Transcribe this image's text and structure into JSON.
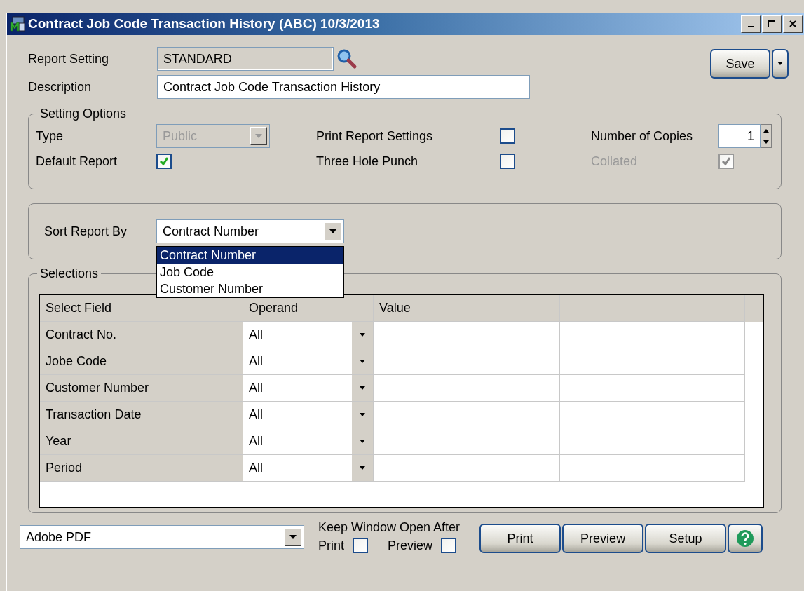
{
  "window": {
    "title": "Contract Job Code Transaction History (ABC) 10/3/2013"
  },
  "report_setting": {
    "label": "Report Setting",
    "value": "STANDARD"
  },
  "description": {
    "label": "Description",
    "value": "Contract Job Code Transaction History"
  },
  "save_button": {
    "label": "Save"
  },
  "setting_options": {
    "title": "Setting Options",
    "type": {
      "label": "Type",
      "value": "Public",
      "disabled": true
    },
    "default_report": {
      "label": "Default Report",
      "checked": true
    },
    "print_report_settings": {
      "label": "Print Report Settings",
      "checked": false
    },
    "three_hole_punch": {
      "label": "Three Hole Punch",
      "checked": false
    },
    "number_of_copies": {
      "label": "Number of Copies",
      "value": "1"
    },
    "collated": {
      "label": "Collated",
      "checked": true,
      "disabled": true
    }
  },
  "sort": {
    "label": "Sort Report By",
    "value": "Contract Number",
    "options": [
      {
        "label": "Contract Number",
        "selected": true
      },
      {
        "label": "Job Code",
        "selected": false
      },
      {
        "label": "Customer Number",
        "selected": false
      }
    ]
  },
  "selections": {
    "title": "Selections",
    "columns": [
      "Select Field",
      "Operand",
      "Value"
    ],
    "rows": [
      {
        "field": "Contract No.",
        "operand": "All"
      },
      {
        "field": "Jobe Code",
        "operand": "All"
      },
      {
        "field": "Customer Number",
        "operand": "All"
      },
      {
        "field": "Transaction Date",
        "operand": "All"
      },
      {
        "field": "Year",
        "operand": "All"
      },
      {
        "field": "Period",
        "operand": "All"
      }
    ]
  },
  "printer": {
    "value": "Adobe PDF"
  },
  "keep_open": {
    "label": "Keep Window Open After",
    "print": {
      "label": "Print",
      "checked": false
    },
    "preview": {
      "label": "Preview",
      "checked": false
    }
  },
  "buttons": [
    "Print",
    "Preview",
    "Setup"
  ]
}
